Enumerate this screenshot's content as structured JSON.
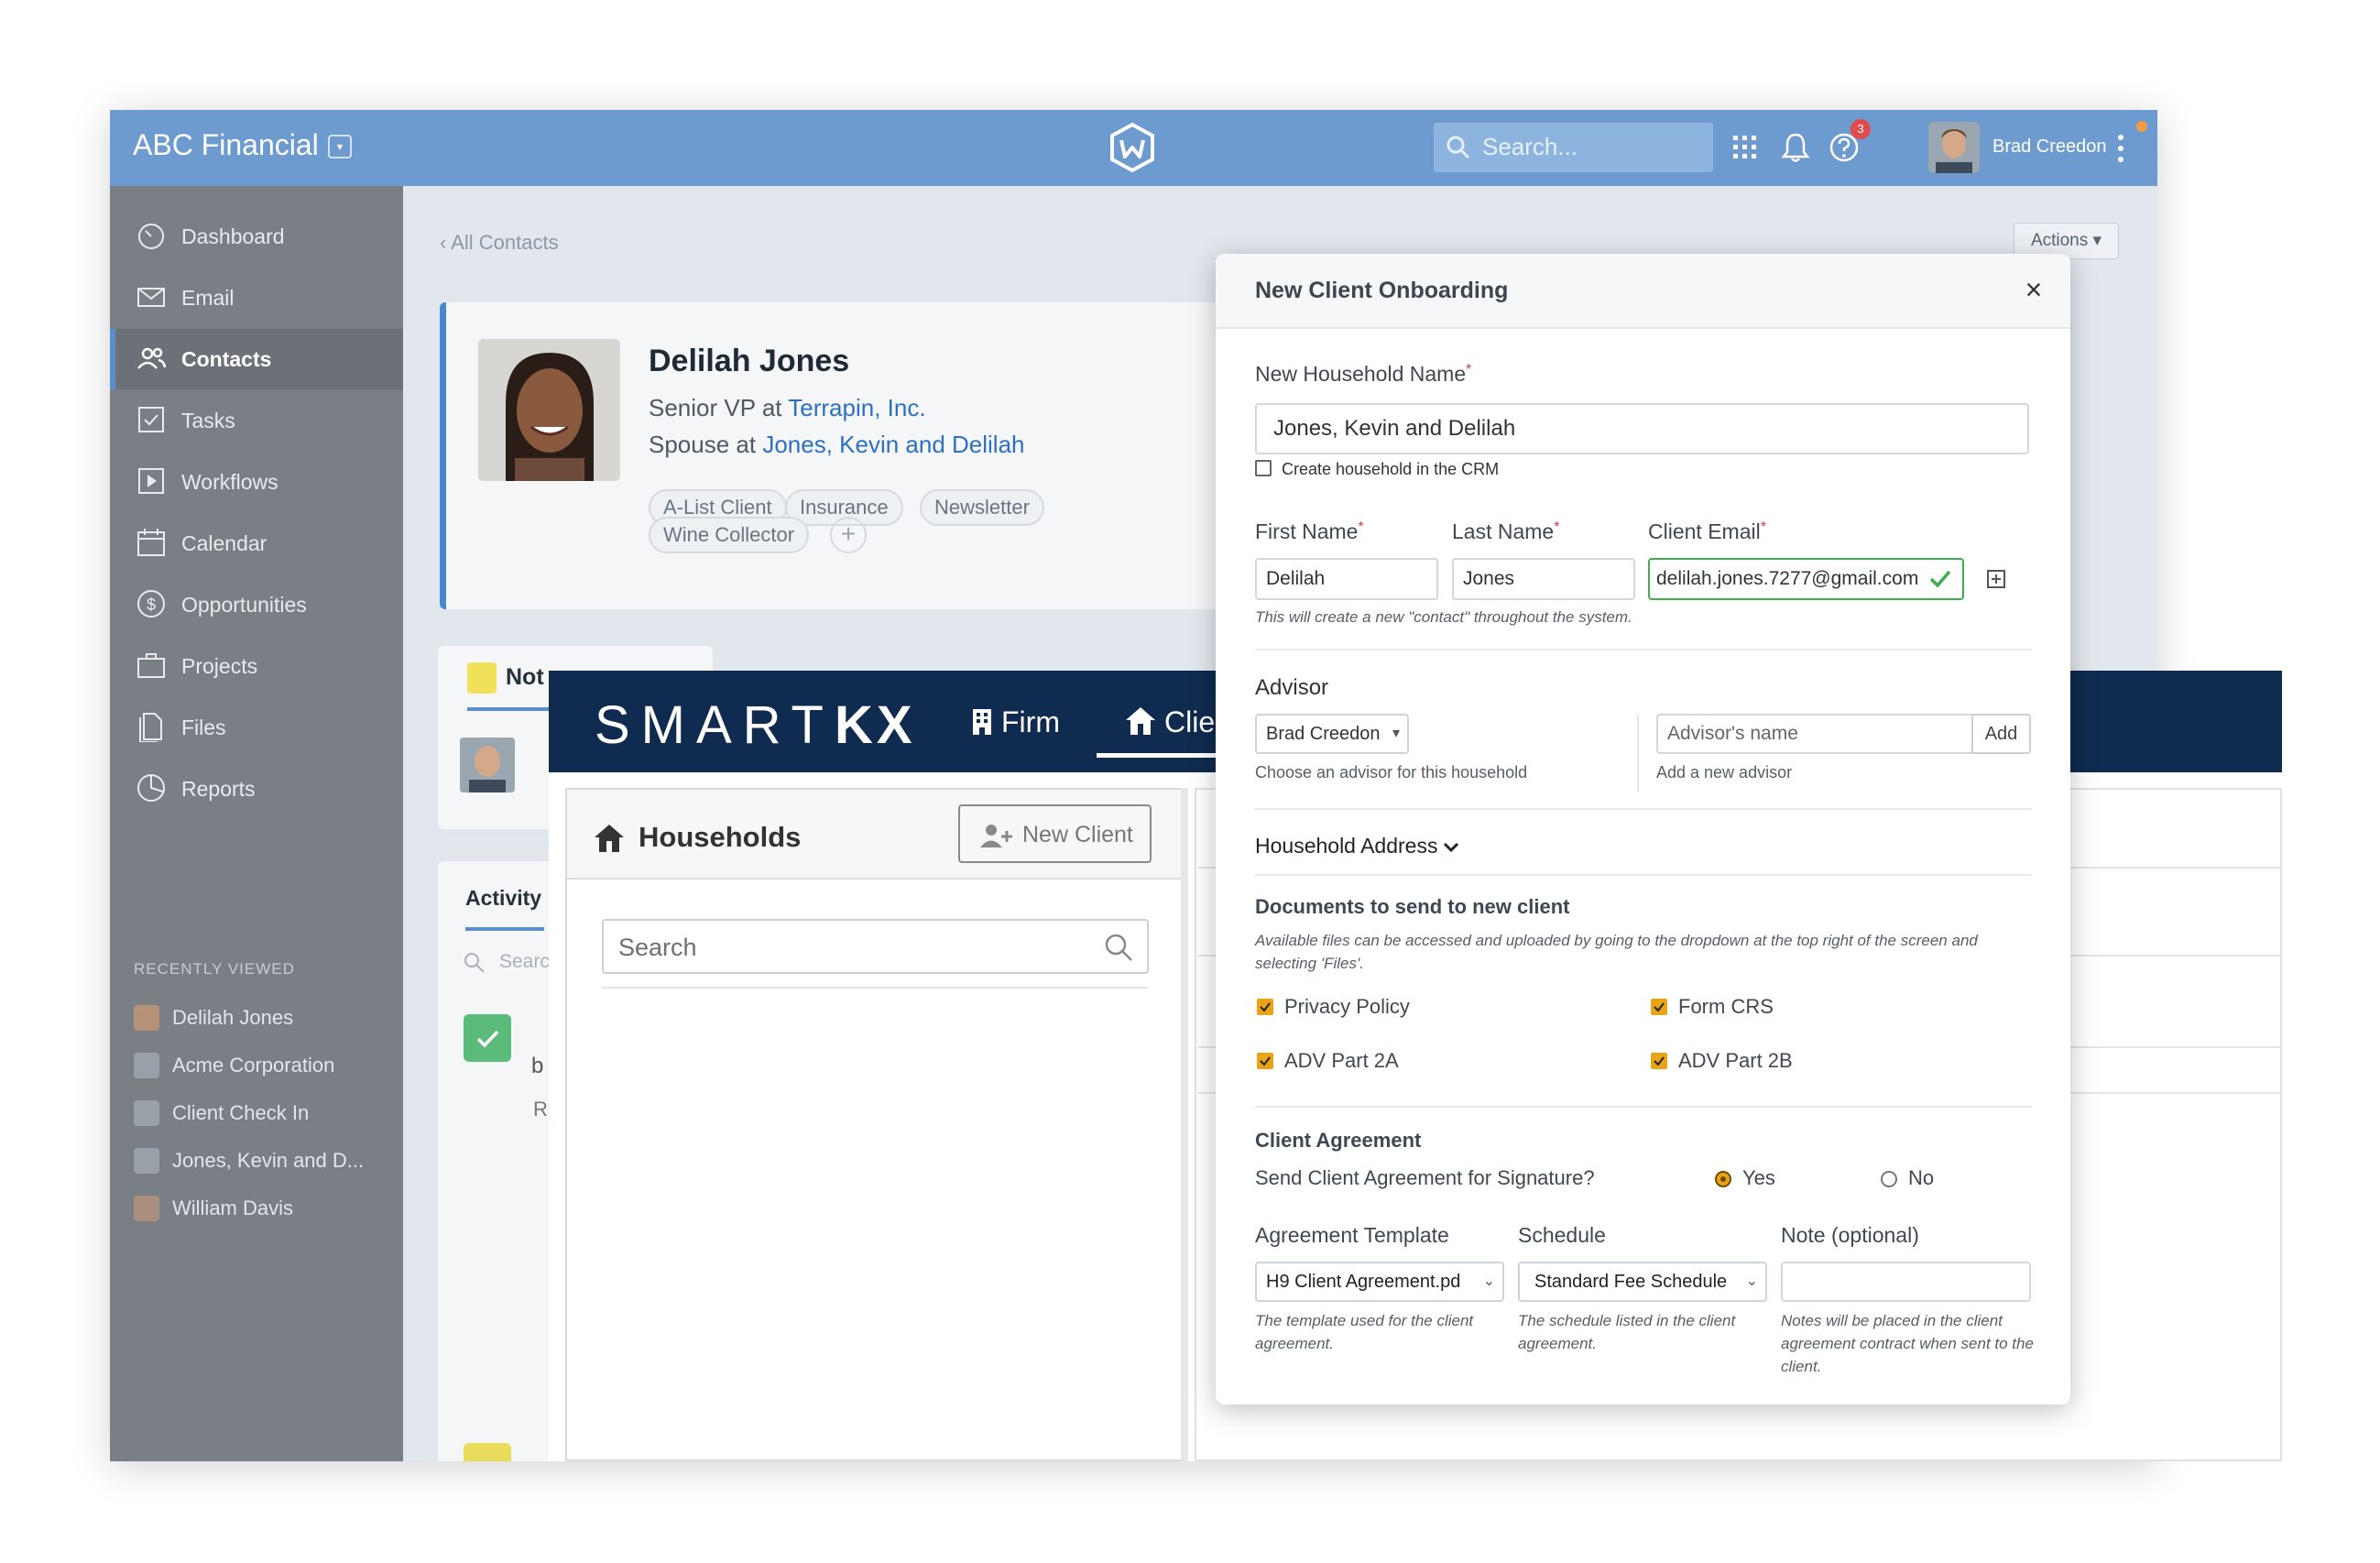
{
  "wealthbox": {
    "brand": "ABC Financial",
    "search_placeholder": "Search...",
    "notification_count": "3",
    "user_name": "Brad Creedon",
    "nav": [
      {
        "label": "Dashboard",
        "icon": "dashboard-icon"
      },
      {
        "label": "Email",
        "icon": "email-icon"
      },
      {
        "label": "Contacts",
        "icon": "contacts-icon",
        "active": true
      },
      {
        "label": "Tasks",
        "icon": "tasks-icon"
      },
      {
        "label": "Workflows",
        "icon": "workflows-icon"
      },
      {
        "label": "Calendar",
        "icon": "calendar-icon"
      },
      {
        "label": "Opportunities",
        "icon": "opportunities-icon"
      },
      {
        "label": "Projects",
        "icon": "projects-icon"
      },
      {
        "label": "Files",
        "icon": "files-icon"
      },
      {
        "label": "Reports",
        "icon": "reports-icon"
      }
    ],
    "recent_heading": "RECENTLY VIEWED",
    "recent": [
      "Delilah Jones",
      "Acme Corporation",
      "Client Check In",
      "Jones, Kevin and D...",
      "William Davis"
    ],
    "breadcrumb": "‹ All Contacts",
    "actions_label": "Actions ▾",
    "contact": {
      "name": "Delilah Jones",
      "role_prefix": "Senior VP at ",
      "company": "Terrapin, Inc.",
      "spouse_prefix": "Spouse at ",
      "household": "Jones, Kevin and Delilah",
      "tags": [
        "A-List Client",
        "Insurance",
        "Newsletter",
        "Wine Collector"
      ]
    },
    "notes_tab": "Not",
    "activity_tab": "Activity",
    "activity_search": "Searc",
    "activity_fragments": [
      "b",
      "R"
    ]
  },
  "smartkx": {
    "logo_light": "SMART",
    "logo_bold": "KX",
    "nav_firm": "Firm",
    "nav_client": "Clier",
    "households_title": "Households",
    "new_client": "New Client",
    "search_placeholder": "Search"
  },
  "modal": {
    "title": "New Client Onboarding",
    "close": "×",
    "household_label": "New Household Name",
    "household_value": "Jones, Kevin and Delilah",
    "create_in_crm": "Create household in the CRM",
    "first_name_label": "First Name",
    "first_name_value": "Delilah",
    "last_name_label": "Last Name",
    "last_name_value": "Jones",
    "email_label": "Client Email",
    "email_value": "delilah.jones.7277@gmail.com",
    "contact_note": "This will create a new \"contact\" throughout the system.",
    "advisor_heading": "Advisor",
    "advisor_selected": "Brad Creedon",
    "advisor_help": "Choose an advisor for this household",
    "advisor_placeholder": "Advisor's name",
    "advisor_add": "Add",
    "advisor_add_help": "Add a new advisor",
    "address_toggle": "Household Address",
    "docs_heading": "Documents to send to new client",
    "docs_help": "Available files can be accessed and uploaded by going to the dropdown at the top right of the screen and selecting 'Files'.",
    "documents": [
      "Privacy Policy",
      "Form CRS",
      "ADV Part 2A",
      "ADV Part 2B"
    ],
    "agreement_heading": "Client Agreement",
    "agreement_question": "Send Client Agreement for Signature?",
    "radio_yes": "Yes",
    "radio_no": "No",
    "template_label": "Agreement Template",
    "template_value": "H9 Client Agreement.pd",
    "template_help": "The template used for the client agreement.",
    "schedule_label": "Schedule",
    "schedule_value": "Standard Fee Schedule",
    "schedule_help": "The schedule listed in the client agreement.",
    "note_label": "Note (optional)",
    "note_help": "Notes will be placed in the client agreement contract when sent to the client."
  },
  "colors": {
    "wealthbox_header": "#6d9bd0",
    "smartkx_header": "#0f2b4f",
    "checkbox_accent": "#e8a317",
    "valid_green": "#3db04b"
  }
}
